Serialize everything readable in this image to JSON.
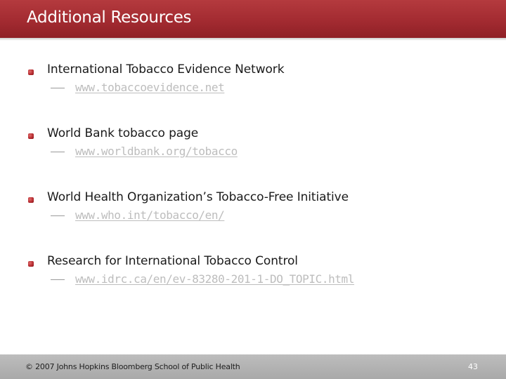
{
  "header": {
    "title": "Additional Resources"
  },
  "resources": [
    {
      "name": "International Tobacco Evidence Network",
      "url": "www.tobaccoevidence.net"
    },
    {
      "name": "World Bank tobacco page",
      "url": "www.worldbank.org/tobacco"
    },
    {
      "name": "World Health Organization’s Tobacco-Free Initiative",
      "url": "www.who.int/tobacco/en/"
    },
    {
      "name": "Research for International Tobacco Control",
      "url": "www.idrc.ca/en/ev-83280-201-1-DO_TOPIC.html"
    }
  ],
  "footer": {
    "copyright": "© 2007 Johns Hopkins Bloomberg School of Public Health",
    "page_number": "43"
  },
  "colors": {
    "title_bar": "#a32b31",
    "bullet": "#b3282d",
    "link": "#bdbdbd",
    "footer": "#b3b3b3"
  }
}
